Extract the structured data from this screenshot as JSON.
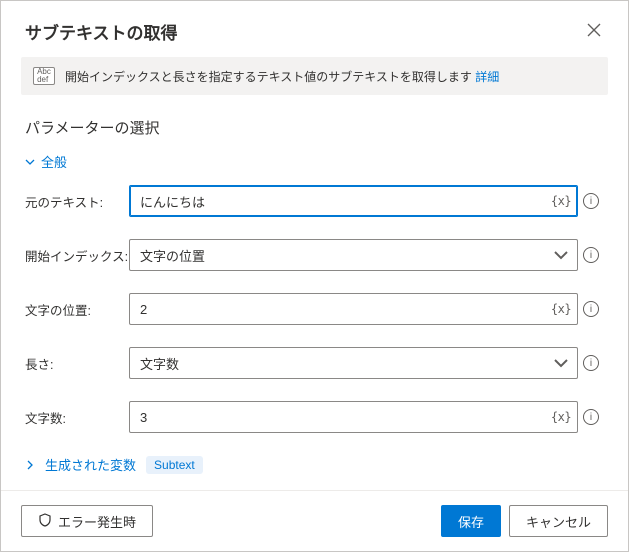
{
  "header": {
    "title": "サブテキストの取得"
  },
  "info": {
    "text": "開始インデックスと長さを指定するテキスト値のサブテキストを取得します",
    "link": "詳細"
  },
  "section": {
    "title": "パラメーターの選択",
    "general_label": "全般"
  },
  "fields": {
    "original_text": {
      "label": "元のテキスト:",
      "value": "にんにちは"
    },
    "start_index": {
      "label": "開始インデックス:",
      "value": "文字の位置"
    },
    "char_position": {
      "label": "文字の位置:",
      "value": "2"
    },
    "length": {
      "label": "長さ:",
      "value": "文字数"
    },
    "char_count": {
      "label": "文字数:",
      "value": "3"
    }
  },
  "generated_vars": {
    "label": "生成された変数",
    "badge": "Subtext"
  },
  "footer": {
    "on_error": "エラー発生時",
    "save": "保存",
    "cancel": "キャンセル"
  }
}
